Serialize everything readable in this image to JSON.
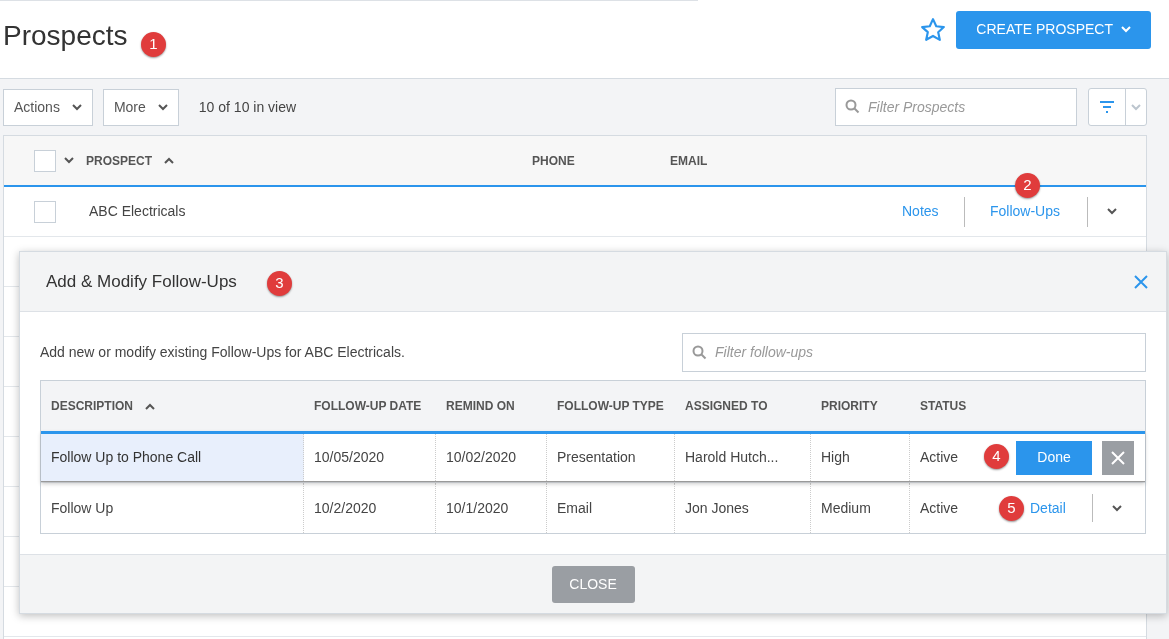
{
  "page": {
    "title": "Prospects",
    "favorite": false,
    "create_button": "CREATE PROSPECT"
  },
  "toolbar": {
    "actions": "Actions",
    "more": "More",
    "count": "10 of 10 in view",
    "filter_placeholder": "Filter Prospects"
  },
  "table": {
    "columns": [
      "PROSPECT",
      "PHONE",
      "EMAIL"
    ],
    "select_all_checked": false,
    "rows": [
      {
        "prospect": "ABC Electricals",
        "checked": false,
        "notes": "Notes",
        "followups": "Follow-Ups"
      }
    ]
  },
  "modal": {
    "title": "Add & Modify Follow-Ups",
    "description": "Add new or modify existing Follow-Ups for ABC Electricals.",
    "filter_placeholder": "Filter follow-ups",
    "columns": [
      "DESCRIPTION",
      "FOLLOW-UP DATE",
      "REMIND ON",
      "FOLLOW-UP TYPE",
      "ASSIGNED TO",
      "PRIORITY",
      "STATUS"
    ],
    "rows": [
      {
        "cells": [
          "Follow Up to Phone Call",
          "10/05/2020",
          "10/02/2020",
          "Presentation",
          "Harold Hutch...",
          "High",
          "Active"
        ],
        "selected": true,
        "kind": "edit",
        "action": "Done"
      },
      {
        "cells": [
          "Follow Up",
          "10/2/2020",
          "10/1/2020",
          "Email",
          "Jon Jones",
          "Medium",
          "Active"
        ],
        "selected": false,
        "kind": "view",
        "action": "Detail"
      }
    ],
    "close_button": "CLOSE"
  },
  "callouts": [
    "1",
    "2",
    "3",
    "4",
    "5"
  ]
}
